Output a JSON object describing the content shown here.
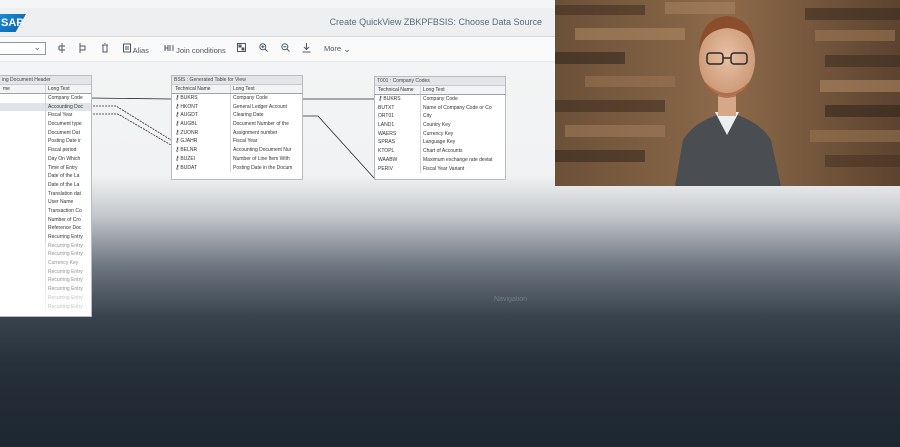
{
  "shell": {
    "logo_text": "SAP",
    "title": "Create QuickView ZBKPFBSIS: Choose Data Source"
  },
  "toolbar": {
    "alias_label": "Alias",
    "join_conditions_label": "Join conditions",
    "more_label": "More"
  },
  "tables": {
    "header_doc": {
      "caption": "ing Document Header",
      "col1": "me",
      "col2": "Long Text",
      "rows": [
        {
          "t": "",
          "l": "Company Code"
        },
        {
          "t": "",
          "l": "Accounting Doc"
        },
        {
          "t": "",
          "l": "Fiscal Year"
        },
        {
          "t": "",
          "l": "Document type"
        },
        {
          "t": "",
          "l": "Document Dat"
        },
        {
          "t": "",
          "l": "Posting Date ir"
        },
        {
          "t": "",
          "l": "Fiscal period"
        },
        {
          "t": "",
          "l": "Day On Which"
        },
        {
          "t": "",
          "l": "Time of Entry"
        },
        {
          "t": "",
          "l": "Date of the La"
        },
        {
          "t": "",
          "l": "Date of the La"
        },
        {
          "t": "",
          "l": "Translation dat"
        },
        {
          "t": "",
          "l": "User Name"
        },
        {
          "t": "",
          "l": "Transaction Co"
        },
        {
          "t": "",
          "l": "Number of Cro"
        },
        {
          "t": "",
          "l": "Reference Doc"
        },
        {
          "t": "",
          "l": "Recurring Entry"
        },
        {
          "t": "",
          "l": "Recurring Entry"
        },
        {
          "t": "",
          "l": "Recurring Entry"
        },
        {
          "t": "",
          "l": "Currency Key"
        },
        {
          "t": "",
          "l": "Recurring Entry"
        },
        {
          "t": "",
          "l": "Recurring Entry"
        },
        {
          "t": "",
          "l": "Recurring Entry"
        },
        {
          "t": "",
          "l": "Recurring Entry"
        },
        {
          "t": "",
          "l": "Recurring Entry"
        }
      ]
    },
    "bsis": {
      "caption": "BSIS : Generated Table for View",
      "col1": "Technical Name",
      "col2": "Long Text",
      "rows": [
        {
          "t": "BUKRS",
          "l": "Company Code"
        },
        {
          "t": "HKONT",
          "l": "General Ledger Account"
        },
        {
          "t": "AUGDT",
          "l": "Clearing Date"
        },
        {
          "t": "AUGBL",
          "l": "Document Number of the"
        },
        {
          "t": "ZUONR",
          "l": "Assignment number"
        },
        {
          "t": "GJAHR",
          "l": "Fiscal Year"
        },
        {
          "t": "BELNR",
          "l": "Accounting Document Nur"
        },
        {
          "t": "BUZEI",
          "l": "Number of Line Item With"
        },
        {
          "t": "BUDAT",
          "l": "Posting Date in the Docum"
        }
      ]
    },
    "t001": {
      "caption": "T001 : Company Codes",
      "col1": "Technical Name",
      "col2": "Long Text",
      "rows": [
        {
          "t": "BUKRS",
          "l": "Company Code"
        },
        {
          "t": "BUTXT",
          "l": "Name of Company Code or Co"
        },
        {
          "t": "ORT01",
          "l": "City"
        },
        {
          "t": "LAND1",
          "l": "Country Key"
        },
        {
          "t": "WAERS",
          "l": "Currency Key"
        },
        {
          "t": "SPRAS",
          "l": "Language Key"
        },
        {
          "t": "KTOPL",
          "l": "Chart of Accounts"
        },
        {
          "t": "WAABW",
          "l": "Maximum exchange rate deviat"
        },
        {
          "t": "PERIV",
          "l": "Fiscal Year Variant"
        }
      ]
    }
  },
  "ghost_button_label": "Navigation",
  "colors": {
    "shell_bg": "#edeff0",
    "accent_blue": "#0a6ed1",
    "dark_overlay": "#1d2631",
    "wood_wall": "#6b5038",
    "sweater": "#4a4e52"
  },
  "icons": {
    "toolbar": [
      "add-table-icon",
      "remove-table-icon",
      "delete-icon",
      "alias-icon",
      "join-icon",
      "grid-icon",
      "zoom-in-icon",
      "zoom-out-icon",
      "download-icon",
      "chevron-down-icon"
    ]
  }
}
